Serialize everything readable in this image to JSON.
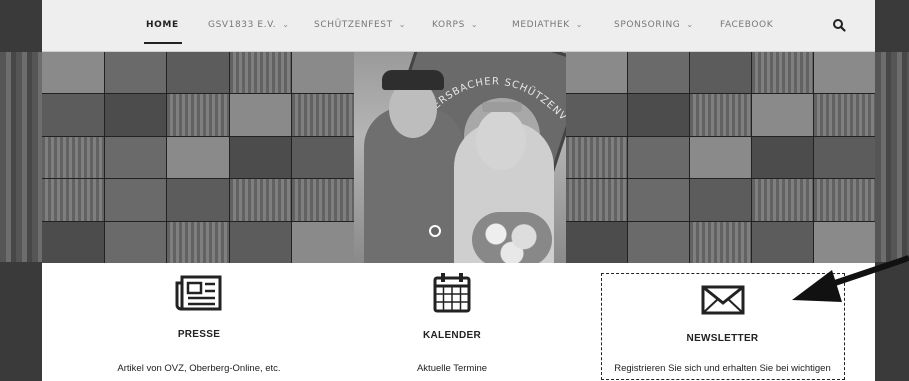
{
  "nav": {
    "items": [
      {
        "label": "HOME",
        "active": true,
        "dropdown": false
      },
      {
        "label": "GSV1833 E.V.",
        "active": false,
        "dropdown": true
      },
      {
        "label": "SCHÜTZENFEST",
        "active": false,
        "dropdown": true
      },
      {
        "label": "KORPS",
        "active": false,
        "dropdown": true
      },
      {
        "label": "MEDIATHEK",
        "active": false,
        "dropdown": true
      },
      {
        "label": "SPONSORING",
        "active": false,
        "dropdown": true
      },
      {
        "label": "FACEBOOK",
        "active": false,
        "dropdown": false
      }
    ],
    "search_icon": "search-icon",
    "caret": "⌄"
  },
  "hero": {
    "banner_text": "GIMMERSBACHER SCHÜTZENVER"
  },
  "features": [
    {
      "icon": "newspaper-icon",
      "title": "PRESSE",
      "desc": "Artikel von OVZ, Oberberg-Online, etc."
    },
    {
      "icon": "calendar-icon",
      "title": "KALENDER",
      "desc": "Aktuelle Termine"
    },
    {
      "icon": "envelope-icon",
      "title": "NEWSLETTER",
      "desc": "Registrieren Sie sich und erhalten Sie bei wichtigen"
    }
  ],
  "colors": {
    "nav_bg": "#eeeeee",
    "side_bg": "#3a3a3a",
    "text": "#222222"
  }
}
